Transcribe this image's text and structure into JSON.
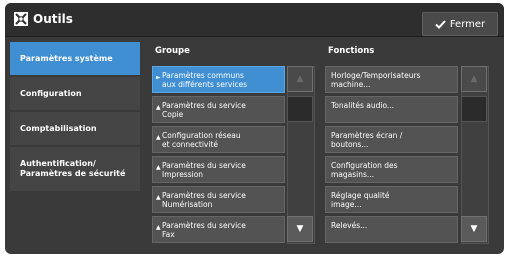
{
  "window": {
    "title": "Outils",
    "close_label": "Fermer"
  },
  "sidebar": {
    "items": [
      {
        "label": "Paramètres système",
        "active": true
      },
      {
        "label": "Configuration",
        "active": false
      },
      {
        "label": "Comptabilisation",
        "active": false
      },
      {
        "label": "Authentification/ Paramètres de sécurité",
        "active": false
      }
    ]
  },
  "group": {
    "header": "Groupe",
    "items": [
      {
        "line1": "Paramètres communs",
        "line2": "aux différents services"
      },
      {
        "line1": "Paramètres du service",
        "line2": "Copie"
      },
      {
        "line1": "Configuration réseau",
        "line2": "et connectivité"
      },
      {
        "line1": "Paramètres du service",
        "line2": "Impression"
      },
      {
        "line1": "Paramètres du service",
        "line2": "Numérisation"
      },
      {
        "line1": "Paramètres du service",
        "line2": "Fax"
      }
    ]
  },
  "functions": {
    "header": "Fonctions",
    "items": [
      {
        "line1": "Horloge/Temporisateurs",
        "line2": "machine..."
      },
      {
        "line1": "Tonalités audio...",
        "line2": ""
      },
      {
        "line1": "Paramètres écran /",
        "line2": "boutons..."
      },
      {
        "line1": "Configuration des",
        "line2": "magasins..."
      },
      {
        "line1": "Réglage qualité",
        "line2": "image..."
      },
      {
        "line1": "Relevés...",
        "line2": ""
      }
    ]
  },
  "scroll": {
    "up_icon": "▲",
    "down_icon": "▼"
  },
  "colors": {
    "accent": "#3f8fd2",
    "panel": "#3a3a3a",
    "row": "#535353"
  }
}
